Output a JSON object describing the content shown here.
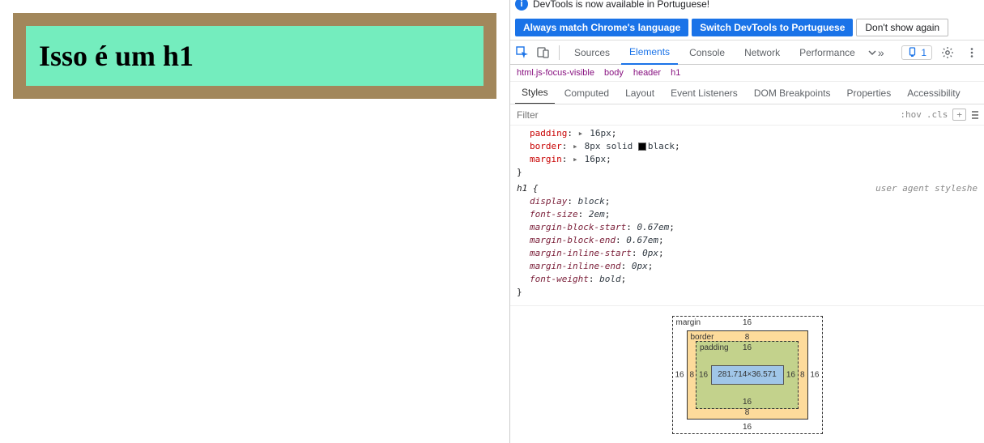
{
  "preview": {
    "h1_text": "Isso é um h1"
  },
  "notification": {
    "message": "DevTools is now available in Portuguese!",
    "btn_always": "Always match Chrome's language",
    "btn_switch": "Switch DevTools to Portuguese",
    "btn_dismiss": "Don't show again"
  },
  "tabs": {
    "items": [
      "Sources",
      "Elements",
      "Console",
      "Network",
      "Performance"
    ],
    "active": "Elements",
    "issues_count": "1"
  },
  "breadcrumb": {
    "items": [
      "html.js-focus-visible",
      "body",
      "header",
      "h1"
    ]
  },
  "subtabs": {
    "items": [
      "Styles",
      "Computed",
      "Layout",
      "Event Listeners",
      "DOM Breakpoints",
      "Properties",
      "Accessibility"
    ],
    "active": "Styles"
  },
  "filter": {
    "placeholder": "Filter",
    "hov": ":hov",
    "cls": ".cls",
    "plus": "+"
  },
  "styles_rules": {
    "author": {
      "props": [
        {
          "name": "padding",
          "value": "16px",
          "tri": true
        },
        {
          "name": "border",
          "value": "8px solid ■ black",
          "tri": true,
          "swatch": "black"
        },
        {
          "name": "margin",
          "value": "16px",
          "tri": true
        }
      ],
      "close": "}"
    },
    "ua": {
      "selector": "h1 {",
      "label": "user agent styleshe",
      "props": [
        {
          "name": "display",
          "value": "block"
        },
        {
          "name": "font-size",
          "value": "2em"
        },
        {
          "name": "margin-block-start",
          "value": "0.67em"
        },
        {
          "name": "margin-block-end",
          "value": "0.67em"
        },
        {
          "name": "margin-inline-start",
          "value": "0px"
        },
        {
          "name": "margin-inline-end",
          "value": "0px"
        },
        {
          "name": "font-weight",
          "value": "bold"
        }
      ],
      "close": "}"
    }
  },
  "boxmodel": {
    "content": "281.714×36.571",
    "padding": "16",
    "border": "8",
    "margin": "16",
    "labels": {
      "margin": "margin",
      "border": "border",
      "padding": "padding"
    }
  }
}
